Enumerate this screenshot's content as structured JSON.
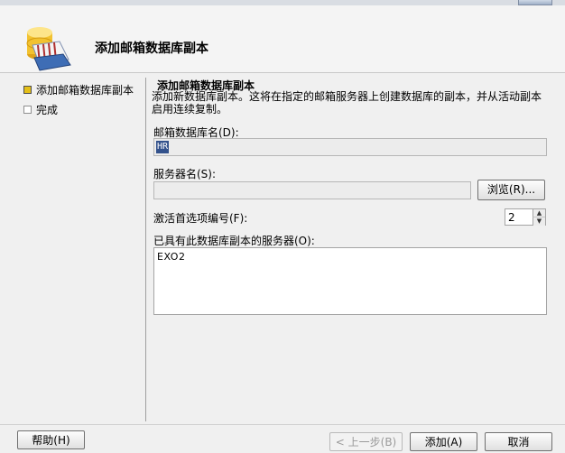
{
  "header": {
    "title": "添加邮箱数据库副本",
    "icon": "database-wizard-icon"
  },
  "nav": {
    "items": [
      {
        "label": "添加邮箱数据库副本",
        "state": "active"
      },
      {
        "label": "完成",
        "state": "inactive"
      }
    ]
  },
  "main": {
    "section_title": "添加邮箱数据库副本",
    "description_line1": "添加新数据库副本。这将在指定的邮箱服务器上创建数据库的副本，并从活动副本",
    "description_line2": "启用连续复制。",
    "db_name_label": "邮箱数据库名(D):",
    "db_name_value": "HR",
    "server_label": "服务器名(S):",
    "server_value": "",
    "browse_label": "浏览(R)...",
    "pref_label": "激活首选项编号(F):",
    "pref_value": "2",
    "servers_label": "已具有此数据库副本的服务器(O):",
    "servers": [
      "EXO2"
    ]
  },
  "footer": {
    "help_label": "帮助(H)",
    "back_label": "< 上一步(B)",
    "add_label": "添加(A)",
    "cancel_label": "取消"
  }
}
